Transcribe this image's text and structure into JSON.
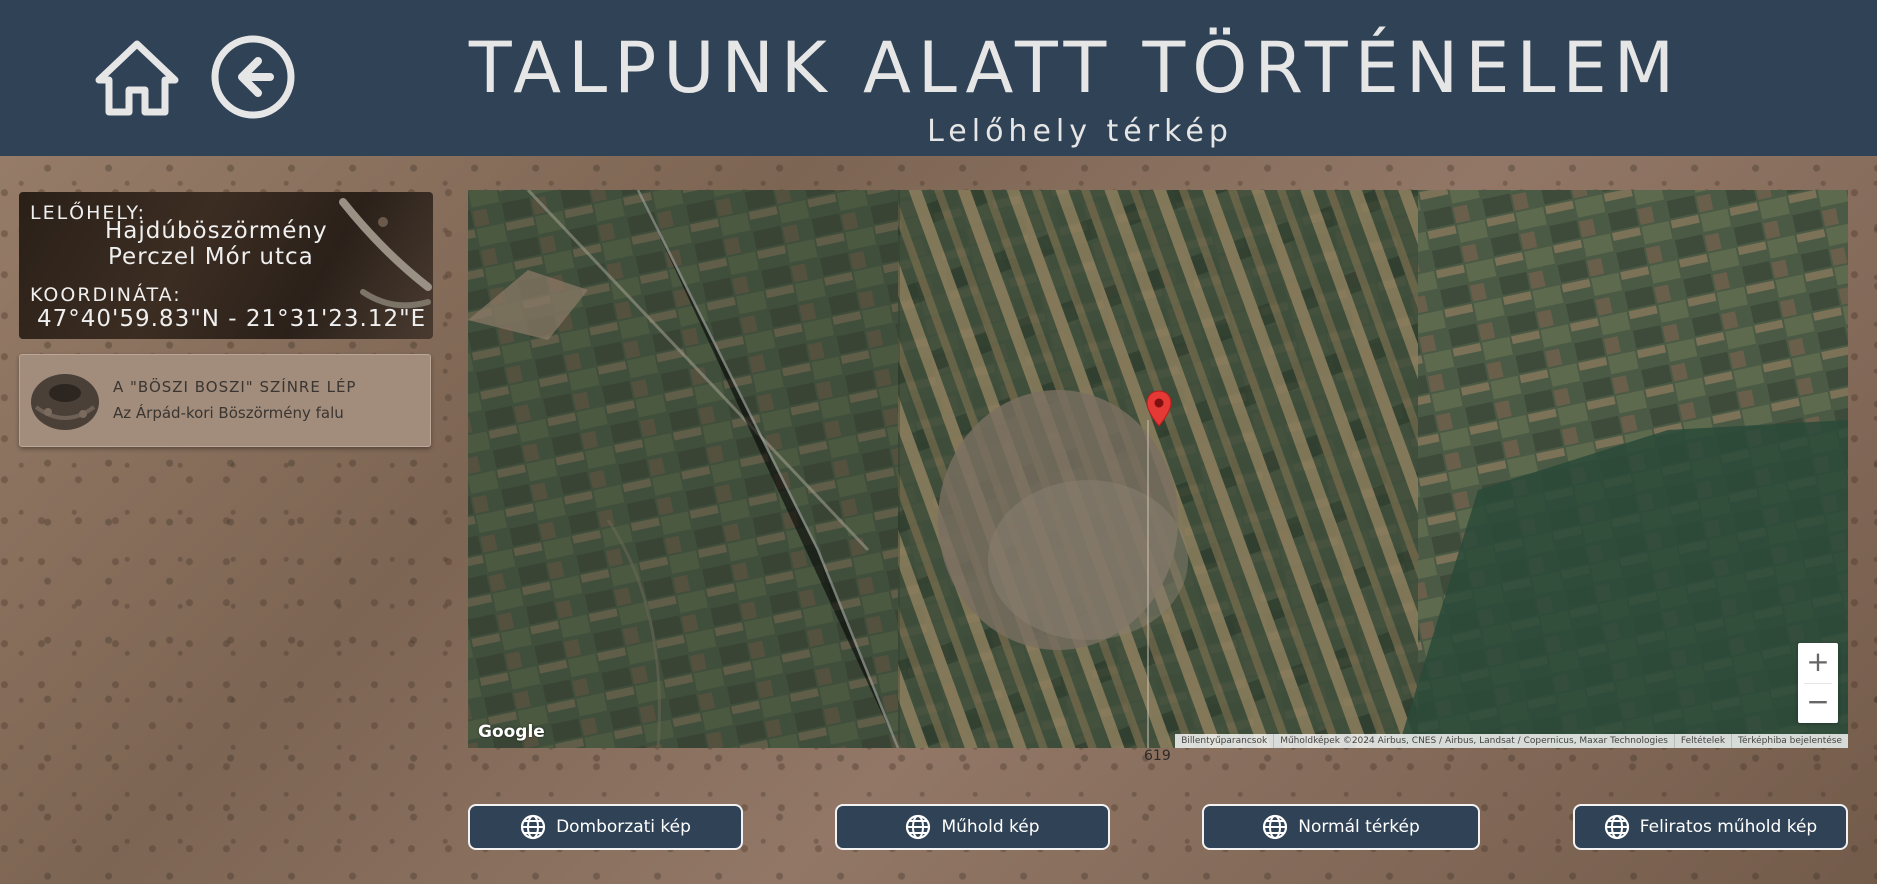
{
  "header": {
    "title": "TALPUNK ALATT TÖRTÉNELEM",
    "subtitle": "Lelőhely térkép",
    "home_icon": "home-icon",
    "back_icon": "arrow-left-circle-icon",
    "bg_color": "#2f4256"
  },
  "site": {
    "location_label": "LELŐHELY:",
    "town": "Hajdúböszörmény",
    "street": "Perczel Mór utca",
    "coord_label": "KOORDINÁTA:",
    "coordinates": "47°40'59.83\"N - 21°31'23.12\"E"
  },
  "story": {
    "title": "A \"BÖSZI BOSZI\" SZÍNRE LÉP",
    "subtitle": "Az Árpád-kori Böszörmény falu"
  },
  "map": {
    "logo": "Google",
    "zoom_in": "+",
    "zoom_out": "−",
    "attribution": [
      "Billentyűparancsok",
      "Műholdképek ©2024 Airbus, CNES / Airbus, Landsat / Copernicus, Maxar Technologies",
      "Feltételek",
      "Térképhiba bejelentése"
    ],
    "marker_icon": "map-pin-icon",
    "marker_color": "#e53935"
  },
  "map_number": "619",
  "buttons": [
    {
      "label": "Domborzati kép",
      "icon": "globe-icon"
    },
    {
      "label": "Műhold kép",
      "icon": "globe-icon"
    },
    {
      "label": "Normál térkép",
      "icon": "globe-icon"
    },
    {
      "label": "Feliratos műhold kép",
      "icon": "globe-icon"
    }
  ]
}
